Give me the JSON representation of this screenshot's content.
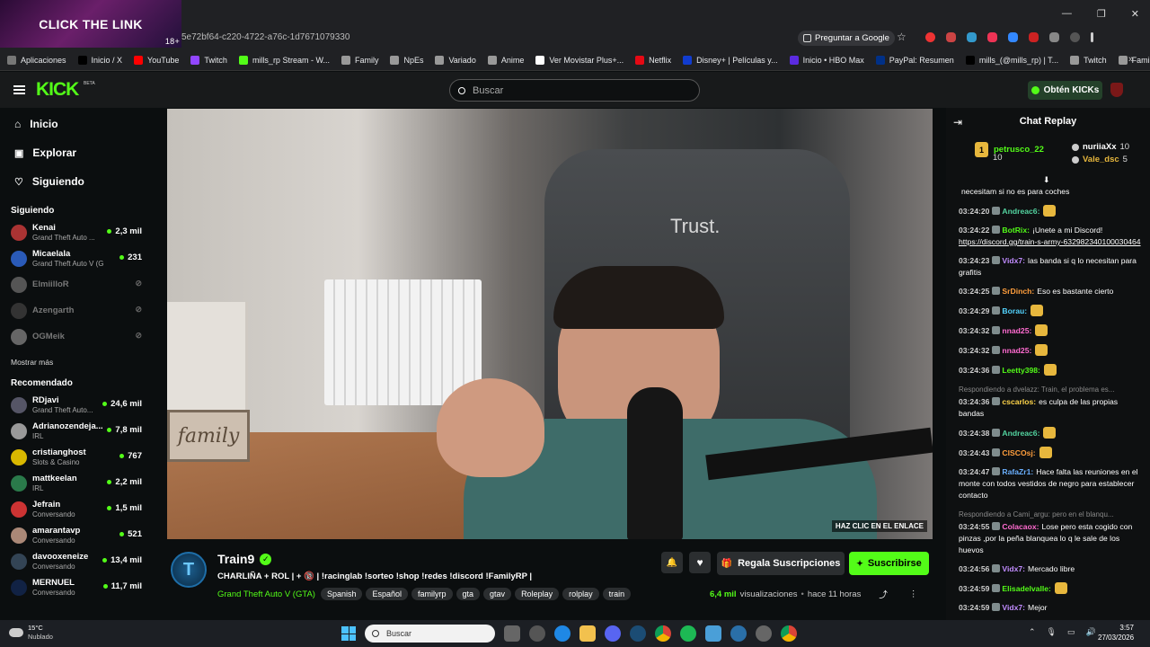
{
  "ad": {
    "text": "CLICK THE LINK",
    "age": "18+"
  },
  "browser": {
    "url": "5e72bf64-c220-4722-a76c-1d7671079330",
    "translate": "Preguntar a Google",
    "bookmarks": [
      {
        "label": "Aplicaciones",
        "color": "#777"
      },
      {
        "label": "Inicio / X",
        "color": "#000"
      },
      {
        "label": "YouTube",
        "color": "#ff0000"
      },
      {
        "label": "Twitch",
        "color": "#9146ff"
      },
      {
        "label": "mills_rp Stream - W...",
        "color": "#53fc18"
      },
      {
        "label": "Family",
        "color": "#999"
      },
      {
        "label": "NpEs",
        "color": "#999"
      },
      {
        "label": "Variado",
        "color": "#999"
      },
      {
        "label": "Anime",
        "color": "#999"
      },
      {
        "label": "Ver Movistar Plus+...",
        "color": "#fff"
      },
      {
        "label": "Netflix",
        "color": "#e50914"
      },
      {
        "label": "Disney+ | Películas y...",
        "color": "#113ccf"
      },
      {
        "label": "Inicio • HBO Max",
        "color": "#5b2be0"
      },
      {
        "label": "PayPal: Resumen",
        "color": "#003087"
      },
      {
        "label": "mills_(@mills_rp) | T...",
        "color": "#000"
      },
      {
        "label": "Twitch",
        "color": "#999"
      },
      {
        "label": "FamilyV1",
        "color": "#999"
      }
    ]
  },
  "header": {
    "logo": "KICK",
    "beta": "BETA",
    "search_placeholder": "Buscar",
    "get_kicks": "Obtén KICKs"
  },
  "sidebar": {
    "nav": [
      "Inicio",
      "Explorar",
      "Siguiendo"
    ],
    "following_title": "Siguiendo",
    "show_more": "Mostrar más",
    "recommended_title": "Recomendado",
    "following": [
      {
        "name": "Kenai",
        "game": "Grand Theft Auto ...",
        "viewers": "2,3 mil",
        "online": true,
        "color": "#a33"
      },
      {
        "name": "Micaelala",
        "game": "Grand Theft Auto V (G...",
        "viewers": "231",
        "online": true,
        "color": "#2a5ab8"
      },
      {
        "name": "ElmiilloR",
        "game": "",
        "viewers": "",
        "online": false,
        "color": "#555"
      },
      {
        "name": "Azengarth",
        "game": "",
        "viewers": "",
        "online": false,
        "color": "#333"
      },
      {
        "name": "OGMeik",
        "game": "",
        "viewers": "",
        "online": false,
        "color": "#666"
      }
    ],
    "recommended": [
      {
        "name": "RDjavi",
        "game": "Grand Theft Auto...",
        "viewers": "24,6 mil",
        "color": "#556"
      },
      {
        "name": "Adrianozendeja...",
        "game": "IRL",
        "viewers": "7,8 mil",
        "color": "#999"
      },
      {
        "name": "cristianghost",
        "game": "Slots & Casino",
        "viewers": "767",
        "color": "#d9b800"
      },
      {
        "name": "mattkeelan",
        "game": "IRL",
        "viewers": "2,2 mil",
        "color": "#2a7a4a"
      },
      {
        "name": "Jefrain",
        "game": "Conversando",
        "viewers": "1,5 mil",
        "color": "#c33"
      },
      {
        "name": "amarantavp",
        "game": "Conversando",
        "viewers": "521",
        "color": "#a87"
      },
      {
        "name": "davooxeneize",
        "game": "Conversando",
        "viewers": "13,4 mil",
        "color": "#345"
      },
      {
        "name": "MERNUEL",
        "game": "Conversando",
        "viewers": "11,7 mil",
        "color": "#124"
      }
    ]
  },
  "video": {
    "overlay": "HAZ CLIC EN EL ENLACE",
    "chair_brand": "Trust.",
    "wall_text": "family"
  },
  "stream": {
    "channel": "Train9",
    "title": "CHARLIÑA + ROL | + 🔞 | !racinglab !sorteo !shop !redes !discord !FamilyRP |",
    "category": "Grand Theft Auto V (GTA)",
    "tags": [
      "Spanish",
      "Español",
      "familyrp",
      "gta",
      "gtav",
      "Roleplay",
      "rolplay",
      "train"
    ],
    "gift_button": "Regala Suscripciones",
    "subscribe_button": "Suscribirse",
    "views": "6,4 mil",
    "views_label": "visualizaciones",
    "time": "hace 11 horas"
  },
  "chat": {
    "title": "Chat Replay",
    "top": [
      {
        "name": "petrusco_22",
        "count": "10",
        "color": "#53fc18"
      },
      {
        "name": "nuriiaXx",
        "count": "10",
        "color": "#fff"
      },
      {
        "name": "Vale_dsc",
        "count": "5",
        "color": "#e7b73d"
      }
    ],
    "messages": [
      {
        "time": "",
        "user": "",
        "color": "#fff",
        "text": "necesitam si no es para coches",
        "emote": false,
        "reply": ""
      },
      {
        "time": "03:24:20",
        "user": "Andreac6:",
        "color": "#53d4a0",
        "text": "",
        "emote": true,
        "reply": ""
      },
      {
        "time": "03:24:22",
        "user": "BotRix:",
        "color": "#53fc18",
        "text": "¡Unete a mi Discord!",
        "link": "https://discord.gg/train-s-army-632982340100030464",
        "emote": false,
        "reply": ""
      },
      {
        "time": "03:24:23",
        "user": "Vidx7:",
        "color": "#c18cff",
        "text": "las banda si q lo necesitan para grafitis",
        "emote": false,
        "reply": ""
      },
      {
        "time": "03:24:25",
        "user": "SrDinch:",
        "color": "#ff9e3d",
        "text": "Eso es bastante cierto",
        "emote": false,
        "reply": ""
      },
      {
        "time": "03:24:29",
        "user": "Borau:",
        "color": "#53d4ff",
        "text": "",
        "emote": true,
        "reply": ""
      },
      {
        "time": "03:24:32",
        "user": "nnad25:",
        "color": "#ff6bd0",
        "text": "",
        "emote": true,
        "reply": ""
      },
      {
        "time": "03:24:32",
        "user": "nnad25:",
        "color": "#ff6bd0",
        "text": "",
        "emote": true,
        "reply": ""
      },
      {
        "time": "03:24:36",
        "user": "Leetty398:",
        "color": "#53fc18",
        "text": "",
        "emote": true,
        "reply": ""
      },
      {
        "time": "03:24:36",
        "user": "cscarlos:",
        "color": "#ffd54a",
        "text": "es culpa de las propias bandas",
        "emote": false,
        "reply": "Respondiendo a dvelazz: Train, el problema es..."
      },
      {
        "time": "03:24:38",
        "user": "Andreac6:",
        "color": "#53d4a0",
        "text": "",
        "emote": true,
        "reply": ""
      },
      {
        "time": "03:24:43",
        "user": "CISCOsj:",
        "color": "#ff9e3d",
        "text": "",
        "emote": true,
        "reply": ""
      },
      {
        "time": "03:24:47",
        "user": "RafaZr1:",
        "color": "#6ab0ff",
        "text": "Hace falta las reuniones en el monte con todos vestidos de negro para establecer contacto",
        "emote": false,
        "reply": ""
      },
      {
        "time": "03:24:55",
        "user": "Colacaox:",
        "color": "#ff6bd0",
        "text": "Lose pero esta cogido con pinzas ,por la peña blanquea lo q le sale de los huevos",
        "emote": false,
        "reply": "Respondiendo a Cami_argu: pero en el blanqu..."
      },
      {
        "time": "03:24:56",
        "user": "Vidx7:",
        "color": "#c18cff",
        "text": "Mercado libre",
        "emote": false,
        "reply": ""
      },
      {
        "time": "03:24:59",
        "user": "Elisadelvalle:",
        "color": "#53fc18",
        "text": "",
        "emote": true,
        "reply": ""
      },
      {
        "time": "03:24:59",
        "user": "Vidx7:",
        "color": "#c18cff",
        "text": "Mejor",
        "emote": false,
        "reply": ""
      }
    ]
  },
  "taskbar": {
    "temp": "15°C",
    "weather": "Nublado",
    "search": "Buscar",
    "time": "3:57",
    "date": "27/03/2026"
  }
}
